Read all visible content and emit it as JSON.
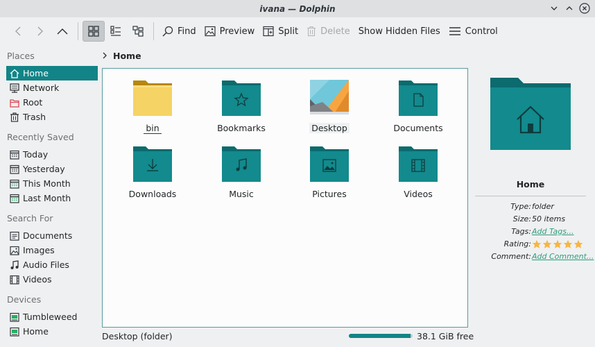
{
  "window": {
    "title": "ivana — Dolphin"
  },
  "toolbar": {
    "find_label": "Find",
    "preview_label": "Preview",
    "split_label": "Split",
    "delete_label": "Delete",
    "hidden_files_label": "Show Hidden Files",
    "control_label": "Control"
  },
  "sidebar": {
    "places_header": "Places",
    "places": [
      {
        "label": "Home",
        "icon": "home-icon"
      },
      {
        "label": "Network",
        "icon": "network-icon"
      },
      {
        "label": "Root",
        "icon": "root-folder-icon"
      },
      {
        "label": "Trash",
        "icon": "trash-icon"
      }
    ],
    "recent_header": "Recently Saved",
    "recent": [
      {
        "label": "Today",
        "icon": "calendar-icon"
      },
      {
        "label": "Yesterday",
        "icon": "calendar-icon"
      },
      {
        "label": "This Month",
        "icon": "calendar-icon"
      },
      {
        "label": "Last Month",
        "icon": "calendar-icon"
      }
    ],
    "search_header": "Search For",
    "search": [
      {
        "label": "Documents",
        "icon": "document-icon"
      },
      {
        "label": "Images",
        "icon": "image-icon"
      },
      {
        "label": "Audio Files",
        "icon": "music-icon"
      },
      {
        "label": "Videos",
        "icon": "video-icon"
      }
    ],
    "devices_header": "Devices",
    "devices": [
      {
        "label": "Tumbleweed",
        "icon": "drive-icon"
      },
      {
        "label": "Home",
        "icon": "drive-icon"
      }
    ]
  },
  "breadcrumb": {
    "current": "Home"
  },
  "files": [
    {
      "name": "bin",
      "icon": "folder-yellow-icon"
    },
    {
      "name": "Bookmarks",
      "icon": "folder-bookmarks-icon"
    },
    {
      "name": "Desktop",
      "icon": "desktop-thumbnail-icon"
    },
    {
      "name": "Documents",
      "icon": "folder-documents-icon"
    },
    {
      "name": "Downloads",
      "icon": "folder-downloads-icon"
    },
    {
      "name": "Music",
      "icon": "folder-music-icon"
    },
    {
      "name": "Pictures",
      "icon": "folder-pictures-icon"
    },
    {
      "name": "Videos",
      "icon": "folder-videos-icon"
    }
  ],
  "status": {
    "selection": "Desktop (folder)",
    "free_space": "38.1 GiB free",
    "used_fraction": 0.97
  },
  "info": {
    "title": "Home",
    "type_label": "Type:",
    "type_value": "folder",
    "size_label": "Size:",
    "size_value": "50 items",
    "tags_label": "Tags:",
    "tags_value": "Add Tags...",
    "rating_label": "Rating:",
    "rating_value": 5,
    "comment_label": "Comment:",
    "comment_value": "Add Comment..."
  },
  "colors": {
    "accent": "#128487",
    "folder_teal": "#138a8d",
    "folder_teal_dark": "#0b6b6e",
    "folder_yellow": "#f5c842",
    "star": "#f7b541",
    "link": "#2e9e7e"
  }
}
